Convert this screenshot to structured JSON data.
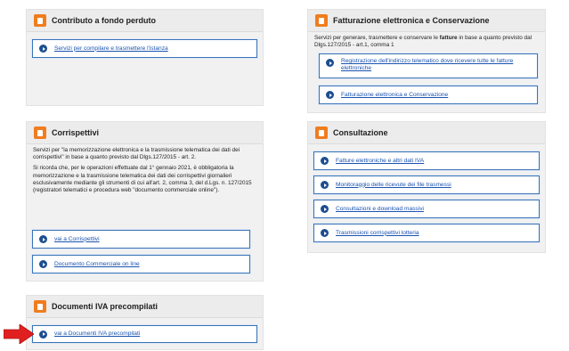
{
  "panels": {
    "contributo": {
      "title": "Contributo a fondo perduto",
      "links": [
        "Servizi per compilare e trasmettere l'istanza"
      ]
    },
    "fatturazione": {
      "title": "Fatturazione elettronica e Conservazione",
      "desc_before": "Servizi per generare, trasmettere e conservare le ",
      "desc_bold": "fatture",
      "desc_after": " in base a quanto previsto dal Dlgs.127/2015 - art.1, comma 1",
      "links": [
        "Registrazione dell'indirizzo telematico dove ricevere tutte le fatture elettroniche",
        "Fatturazione elettronica e Conservazione"
      ]
    },
    "corrispettivi": {
      "title": "Corrispettivi",
      "p1": "Servizi per \"la memorizzazione elettronica e la trasmissione telematica dei dati dei corrispettivi\" in base a quanto previsto dal Dlgs.127/2015 - art. 2.",
      "p2": "Si ricorda che, per le operazioni effettuate dal 1° gennaio 2021, è obbligatoria la memorizzazione e la trasmissione telematica dei dati dei corrispettivi giornalieri esclusivamente mediante gli strumenti di cui all'art. 2, comma 3, del d.Lgs. n. 127/2015 (registratori telematici e procedura web \"documento commerciale online\").",
      "links": [
        "vai a Corrispettivi",
        "Documento Commerciale on line"
      ]
    },
    "consultazione": {
      "title": "Consultazione",
      "links": [
        "Fatture elettroniche e altri dati IVA",
        "Monitoraggio delle ricevute dei file trasmessi",
        "Consultazioni e download massivi",
        "Trasmissioni corrispettivi lotteria"
      ]
    },
    "documenti": {
      "title": "Documenti IVA precompilati",
      "links": [
        "vai a Documenti IVA precompilati"
      ]
    }
  },
  "colors": {
    "accent_orange": "#f07d1e",
    "link_blue": "#1a53b0",
    "border_blue": "#3a74b8",
    "arrow_red": "#e02020"
  }
}
